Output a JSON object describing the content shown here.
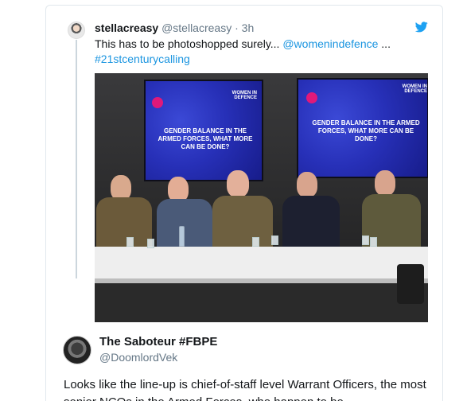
{
  "quoted_tweet": {
    "display_name": "stellacreasy",
    "handle": "@stellacreasy",
    "separator": "·",
    "time": "3h",
    "text_plain": "This has to be photoshopped surely... ",
    "mention": "@womenindefence",
    "ellipsis": " ...",
    "hashtag": "#21stcenturycalling",
    "icon": "twitter-bird-icon",
    "photo": {
      "screen_logo": "WOMEN IN DEFENCE",
      "screen_question": "GENDER BALANCE IN THE ARMED FORCES, WHAT MORE CAN BE DONE?"
    }
  },
  "reply": {
    "display_name": "The Saboteur #FBPE",
    "handle": "@DoomlordVek",
    "text": "Looks like the line-up is chief-of-staff level Warrant Officers, the most senior NCOs in the Armed Forces, who happen to be"
  },
  "colors": {
    "link": "#1b95e0",
    "secondary_text": "#657786",
    "border": "#e1e8ed",
    "twitter_blue": "#1da1f2"
  }
}
